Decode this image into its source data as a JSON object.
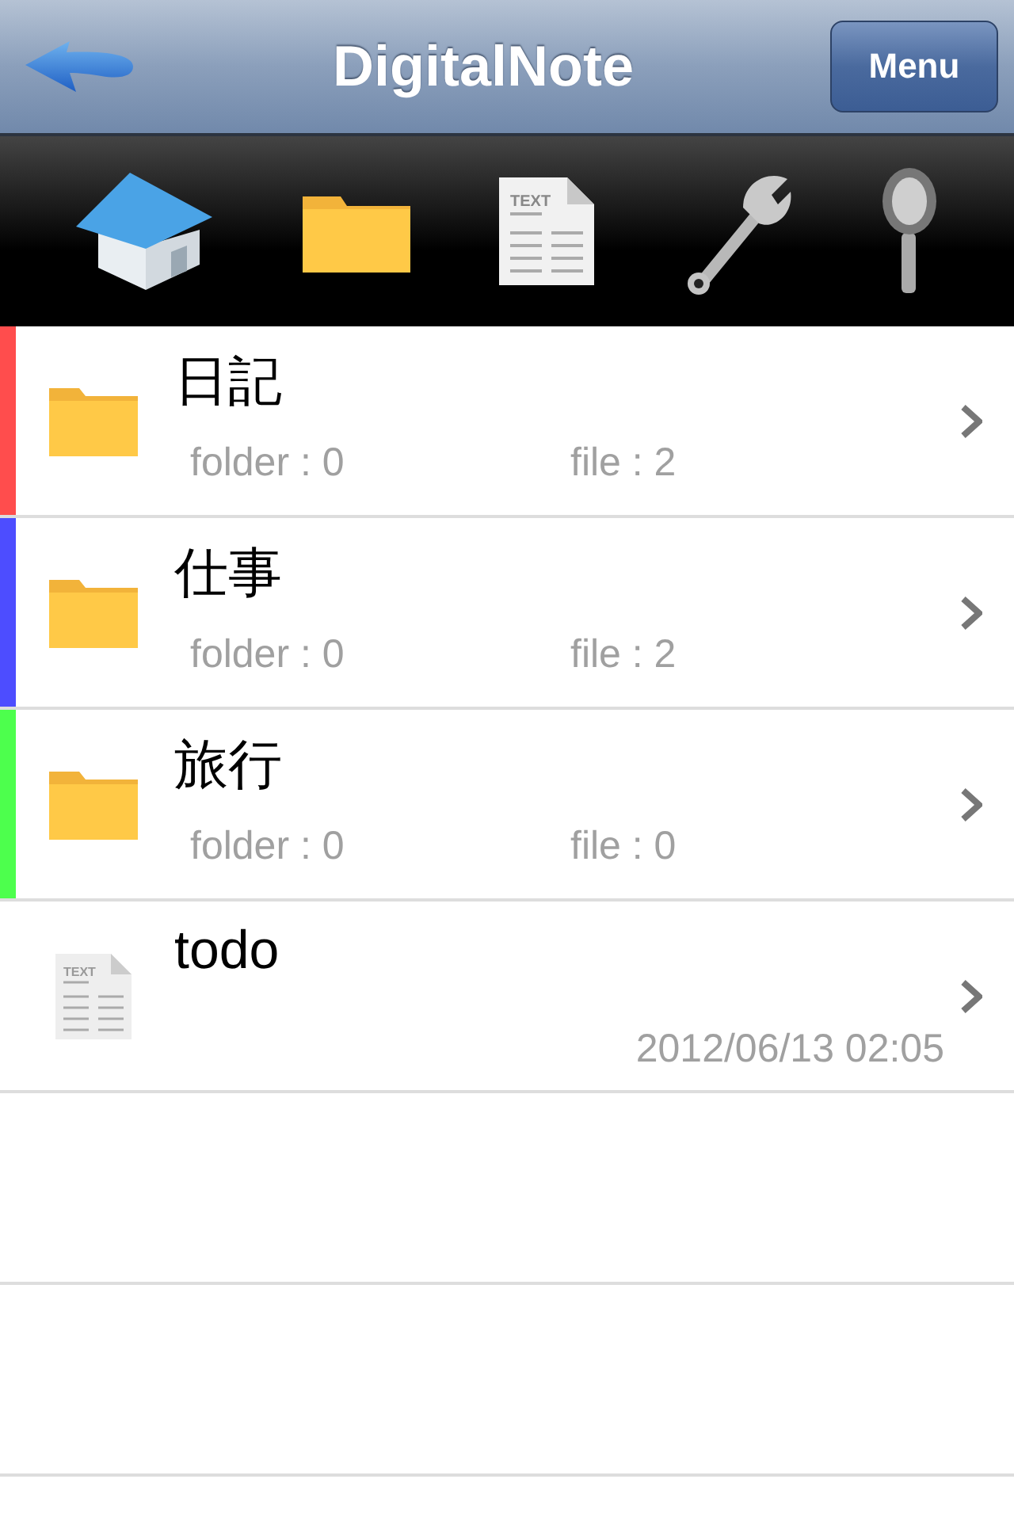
{
  "nav": {
    "title": "DigitalNote",
    "menu_button": "Menu"
  },
  "toolbar": [
    {
      "kind": "home"
    },
    {
      "kind": "folder"
    },
    {
      "kind": "document",
      "icon_label": "TEXT"
    },
    {
      "kind": "wrench"
    },
    {
      "kind": "search"
    }
  ],
  "items": [
    {
      "kind": "folder",
      "name": "日記",
      "color": "#ff4d4d",
      "folder_count": "folder : 0",
      "file_count": "file : 2"
    },
    {
      "kind": "folder",
      "name": "仕事",
      "color": "#4d4dff",
      "folder_count": "folder : 0",
      "file_count": "file : 2"
    },
    {
      "kind": "folder",
      "name": "旅行",
      "color": "#4dff4d",
      "folder_count": "folder : 0",
      "file_count": "file : 0"
    },
    {
      "kind": "file",
      "name": "todo",
      "icon_label": "TEXT",
      "date": "2012/06/13 02:05"
    }
  ]
}
